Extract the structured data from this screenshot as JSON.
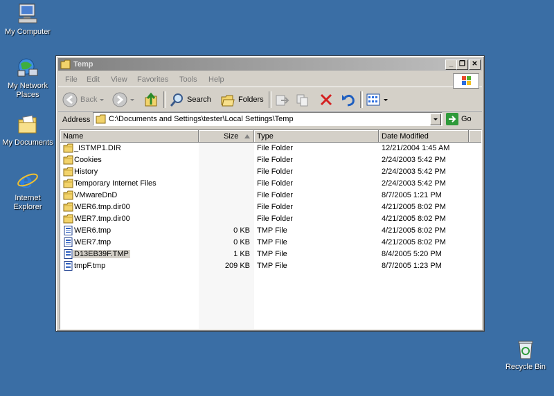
{
  "desktop": {
    "icons": [
      {
        "label": "My Computer"
      },
      {
        "label": "My Network Places"
      },
      {
        "label": "My Documents"
      },
      {
        "label": "Internet Explorer"
      },
      {
        "label": "Recycle Bin"
      }
    ]
  },
  "window": {
    "title": "Temp",
    "controls": {
      "minimize": "_",
      "restore": "❐",
      "close": "✕"
    }
  },
  "menu": [
    "File",
    "Edit",
    "View",
    "Favorites",
    "Tools",
    "Help"
  ],
  "toolbar": {
    "back": "Back",
    "search": "Search",
    "folders": "Folders"
  },
  "address": {
    "label": "Address",
    "value": "C:\\Documents and Settings\\tester\\Local Settings\\Temp",
    "go": "Go"
  },
  "columns": [
    "Name",
    "Size",
    "Type",
    "Date Modified"
  ],
  "files": [
    {
      "name": "_ISTMP1.DIR",
      "size": "",
      "type": "File Folder",
      "date": "12/21/2004 1:45 AM",
      "kind": "folder"
    },
    {
      "name": "Cookies",
      "size": "",
      "type": "File Folder",
      "date": "2/24/2003 5:42 PM",
      "kind": "folder"
    },
    {
      "name": "History",
      "size": "",
      "type": "File Folder",
      "date": "2/24/2003 5:42 PM",
      "kind": "folder"
    },
    {
      "name": "Temporary Internet Files",
      "size": "",
      "type": "File Folder",
      "date": "2/24/2003 5:42 PM",
      "kind": "folder"
    },
    {
      "name": "VMwareDnD",
      "size": "",
      "type": "File Folder",
      "date": "8/7/2005 1:21 PM",
      "kind": "folder"
    },
    {
      "name": "WER6.tmp.dir00",
      "size": "",
      "type": "File Folder",
      "date": "4/21/2005 8:02 PM",
      "kind": "folder"
    },
    {
      "name": "WER7.tmp.dir00",
      "size": "",
      "type": "File Folder",
      "date": "4/21/2005 8:02 PM",
      "kind": "folder"
    },
    {
      "name": "WER6.tmp",
      "size": "0 KB",
      "type": "TMP File",
      "date": "4/21/2005 8:02 PM",
      "kind": "file"
    },
    {
      "name": "WER7.tmp",
      "size": "0 KB",
      "type": "TMP File",
      "date": "4/21/2005 8:02 PM",
      "kind": "file"
    },
    {
      "name": "D13EB39F.TMP",
      "size": "1 KB",
      "type": "TMP File",
      "date": "8/4/2005 5:20 PM",
      "kind": "file",
      "selected": true
    },
    {
      "name": "tmpF.tmp",
      "size": "209 KB",
      "type": "TMP File",
      "date": "8/7/2005 1:23 PM",
      "kind": "file"
    }
  ],
  "colors": {
    "desktop": "#3A6EA5",
    "titlebar_inactive": "#808080",
    "chrome": "#D4D0C8"
  }
}
